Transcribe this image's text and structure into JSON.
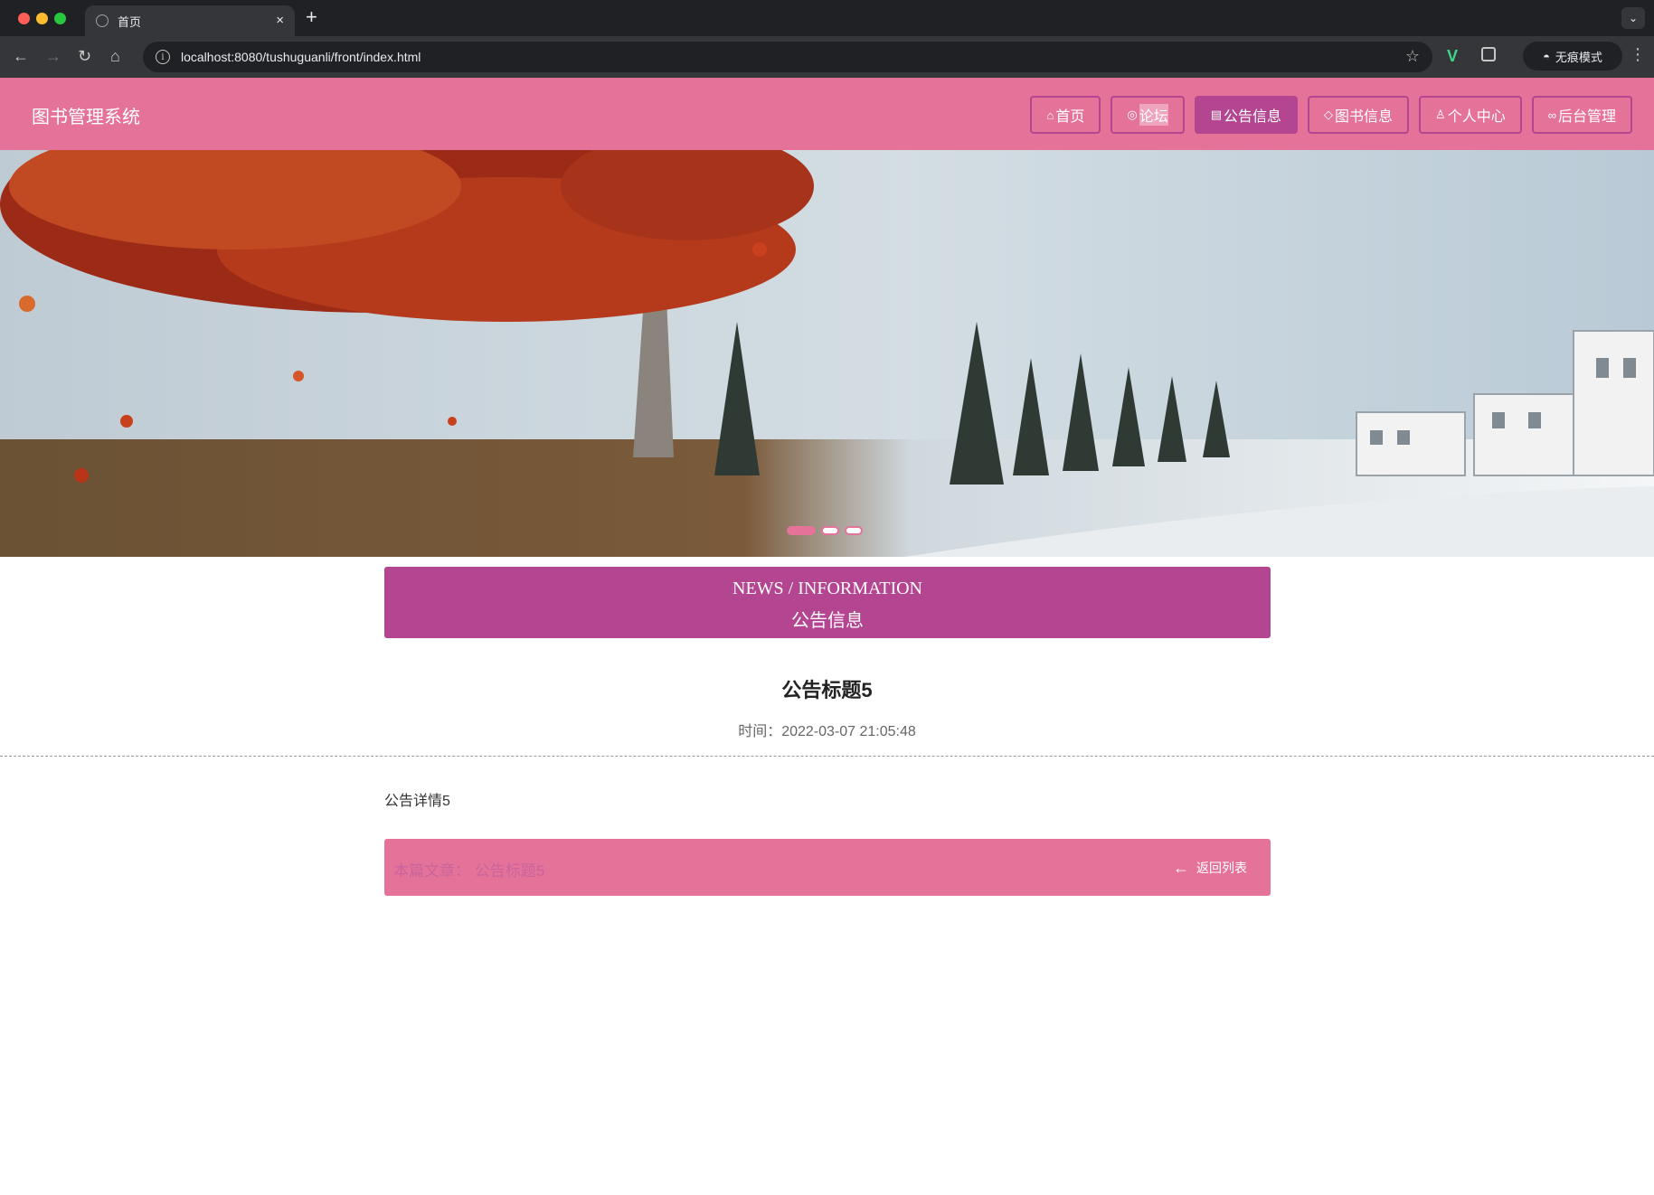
{
  "browser": {
    "tab_title": "首页",
    "tab_close": "×",
    "new_tab": "+",
    "tab_menu": "⌄",
    "url": "localhost:8080/tushuguanli/front/index.html",
    "incognito_label": "无痕模式"
  },
  "site": {
    "title": "图书管理系统",
    "nav": [
      {
        "label": "首页",
        "icon": "home-icon"
      },
      {
        "label": "论坛",
        "icon": "globe-icon"
      },
      {
        "label": "公告信息",
        "icon": "printer-icon"
      },
      {
        "label": "图书信息",
        "icon": "tag-icon"
      },
      {
        "label": "个人中心",
        "icon": "user-icon"
      },
      {
        "label": "后台管理",
        "icon": "link-icon"
      }
    ],
    "accent_color": "#e57399",
    "active_color": "#b34591"
  },
  "banner": {
    "slide_count": 3,
    "active_slide": 1
  },
  "section": {
    "heading_en": "NEWS / INFORMATION",
    "heading_zh": "公告信息"
  },
  "article": {
    "title": "公告标题5",
    "time": "时间：2022-03-07 21:05:48",
    "body": "公告详情5",
    "this_article": "本篇文章：  公告标题5",
    "back_label": "返回列表"
  }
}
